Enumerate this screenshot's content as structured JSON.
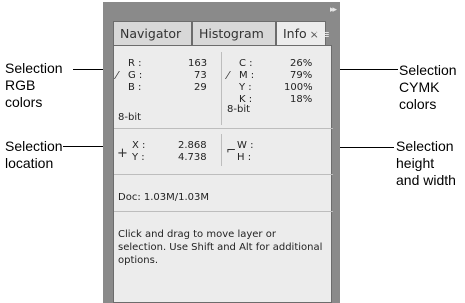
{
  "callouts": {
    "rgb": "Selection\nRGB\ncolors",
    "location": "Selection\nlocation",
    "cmyk": "Selection\nCYMK\ncolors",
    "size": "Selection\nheight\nand width"
  },
  "tabs": [
    {
      "label": "Navigator"
    },
    {
      "label": "Histogram"
    },
    {
      "label": "Info",
      "close": "×"
    }
  ],
  "topbar": {
    "collapse_icon": "▸▸",
    "menu_icon": "▾≡"
  },
  "rgb": {
    "labels": [
      "R :",
      "G :",
      "B :"
    ],
    "values": [
      "163",
      "73",
      "29"
    ],
    "bitdepth": "8-bit"
  },
  "cmyk": {
    "labels": [
      "C :",
      "M :",
      "Y :",
      "K :"
    ],
    "values": [
      "26%",
      "79%",
      "100%",
      "18%"
    ],
    "bitdepth": "8-bit"
  },
  "position": {
    "labels": [
      "X :",
      "Y :"
    ],
    "values": [
      "2.868",
      "4.738"
    ]
  },
  "size": {
    "labels": [
      "W :",
      "H :"
    ]
  },
  "doc": "Doc: 1.03M/1.03M",
  "hint": "Click and drag to move layer or selection.  Use Shift and Alt for additional options."
}
